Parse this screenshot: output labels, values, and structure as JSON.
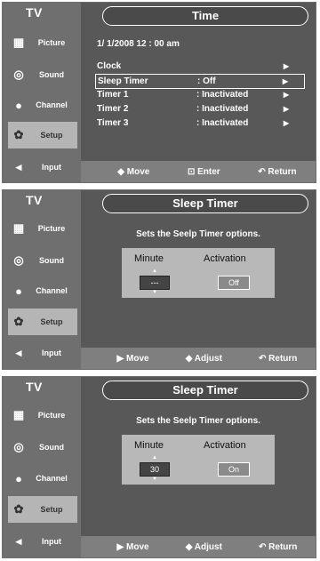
{
  "sidebar": {
    "title": "TV",
    "items": [
      {
        "label": "Picture"
      },
      {
        "label": "Sound"
      },
      {
        "label": "Channel"
      },
      {
        "label": "Setup"
      },
      {
        "label": "Input"
      }
    ]
  },
  "screen1": {
    "title": "Time",
    "datetime": "1/  1/2008  12 : 00 am",
    "rows": [
      {
        "label": "Clock",
        "value": "",
        "arrow": "▶"
      },
      {
        "label": "Sleep Timer",
        "value": ": Off",
        "arrow": "▶"
      },
      {
        "label": "Timer 1",
        "value": ": Inactivated",
        "arrow": "▶"
      },
      {
        "label": "Timer 2",
        "value": ": Inactivated",
        "arrow": "▶"
      },
      {
        "label": "Timer 3",
        "value": ": Inactivated",
        "arrow": "▶"
      }
    ],
    "footer": {
      "move": "◆ Move",
      "enter": "⊡ Enter",
      "return": "↶ Return"
    }
  },
  "screen2": {
    "title": "Sleep Timer",
    "description": "Sets the Seelp Timer options.",
    "col_minute": "Minute",
    "col_activation": "Activation",
    "minute_value": "---",
    "activation_value": "Off",
    "footer": {
      "move": "▶ Move",
      "adjust": "◆ Adjust",
      "return": "↶ Return"
    }
  },
  "screen3": {
    "title": "Sleep Timer",
    "description": "Sets the Seelp Timer options.",
    "col_minute": "Minute",
    "col_activation": "Activation",
    "minute_value": "30",
    "activation_value": "On",
    "footer": {
      "move": "▶ Move",
      "adjust": "◆ Adjust",
      "return": "↶ Return"
    }
  }
}
